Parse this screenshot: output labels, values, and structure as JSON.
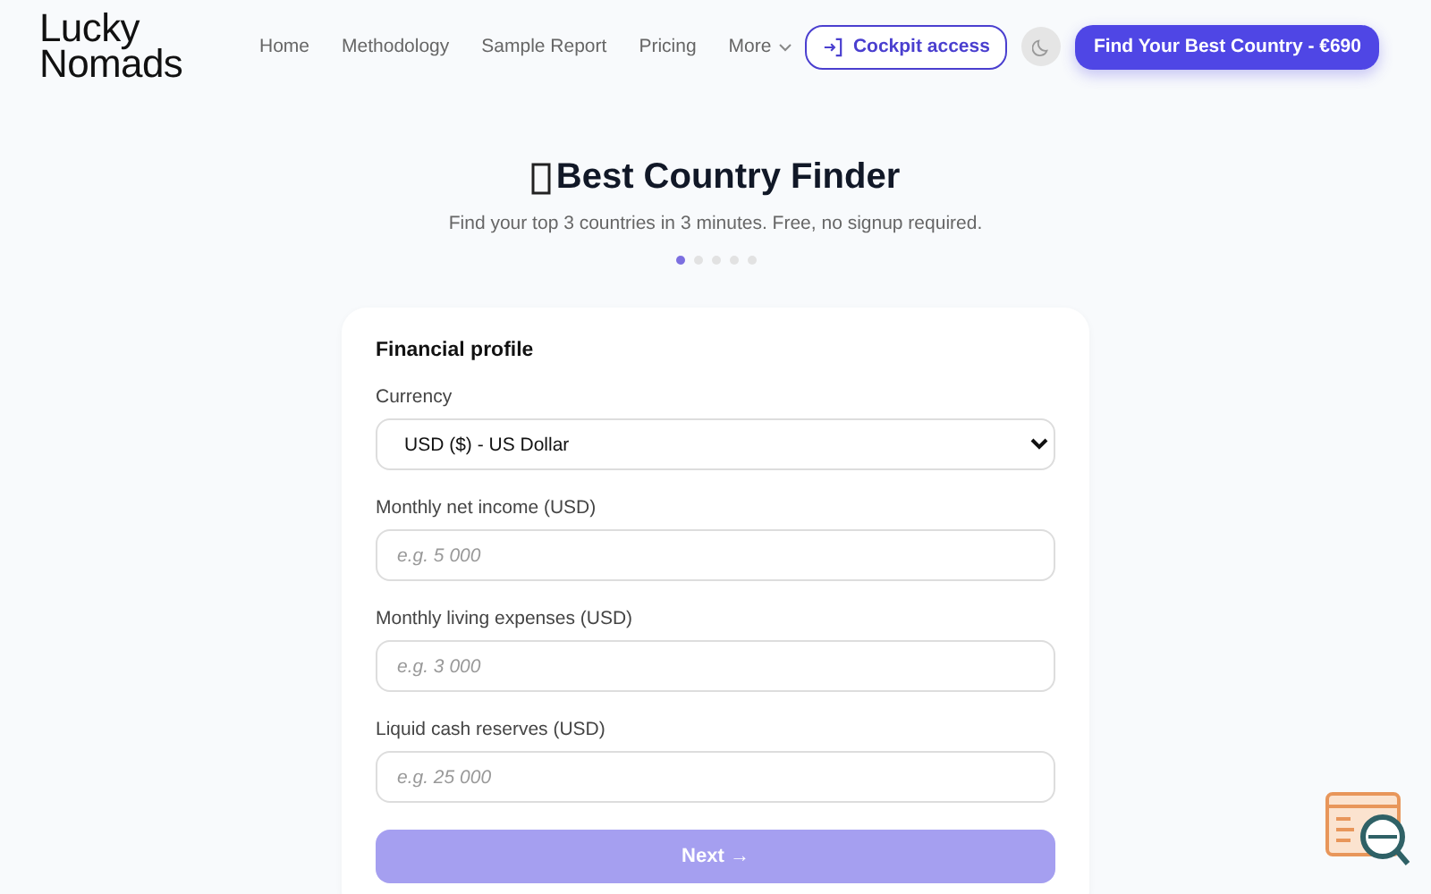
{
  "logo": "Lucky Nomads",
  "nav": [
    {
      "label": "Home"
    },
    {
      "label": "Methodology"
    },
    {
      "label": "Sample Report"
    },
    {
      "label": "Pricing"
    },
    {
      "label": "More",
      "dropdown": true
    }
  ],
  "cockpit_button": "Cockpit access",
  "cta_button": "Find Your Best Country - €690",
  "title": "Best Country Finder",
  "subtitle": "Find your top 3 countries in 3 minutes. Free, no signup required.",
  "steps": [
    {
      "selected": true
    },
    {
      "selected": false
    },
    {
      "selected": false
    },
    {
      "selected": false
    },
    {
      "selected": false
    }
  ],
  "form": {
    "heading": "Financial profile",
    "fields": [
      {
        "kind": "select",
        "label": "Currency",
        "value": "USD ($) - US Dollar"
      },
      {
        "kind": "input",
        "label": "Monthly net income (USD)",
        "placeholder": "e.g. 5 000"
      },
      {
        "kind": "input",
        "label": "Monthly living expenses (USD)",
        "placeholder": "e.g. 3 000"
      },
      {
        "kind": "input",
        "label": "Liquid cash reserves (USD)",
        "placeholder": "e.g. 25 000"
      }
    ],
    "next_button": {
      "label": "Next →",
      "disabled": true
    }
  }
}
